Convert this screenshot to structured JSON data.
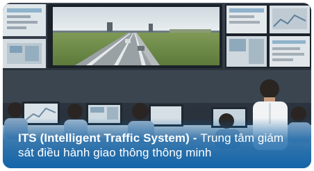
{
  "caption": {
    "title": "ITS (Intelligent Traffic System)",
    "separator": " - ",
    "description": "Trung tâm giám sát điều hành giao thông thông minh"
  },
  "colors": {
    "caption_overlay": "#0c62aa",
    "caption_text": "#ffffff",
    "card_border": "#f2d24a"
  },
  "icons": {
    "photo": "traffic-control-room"
  }
}
